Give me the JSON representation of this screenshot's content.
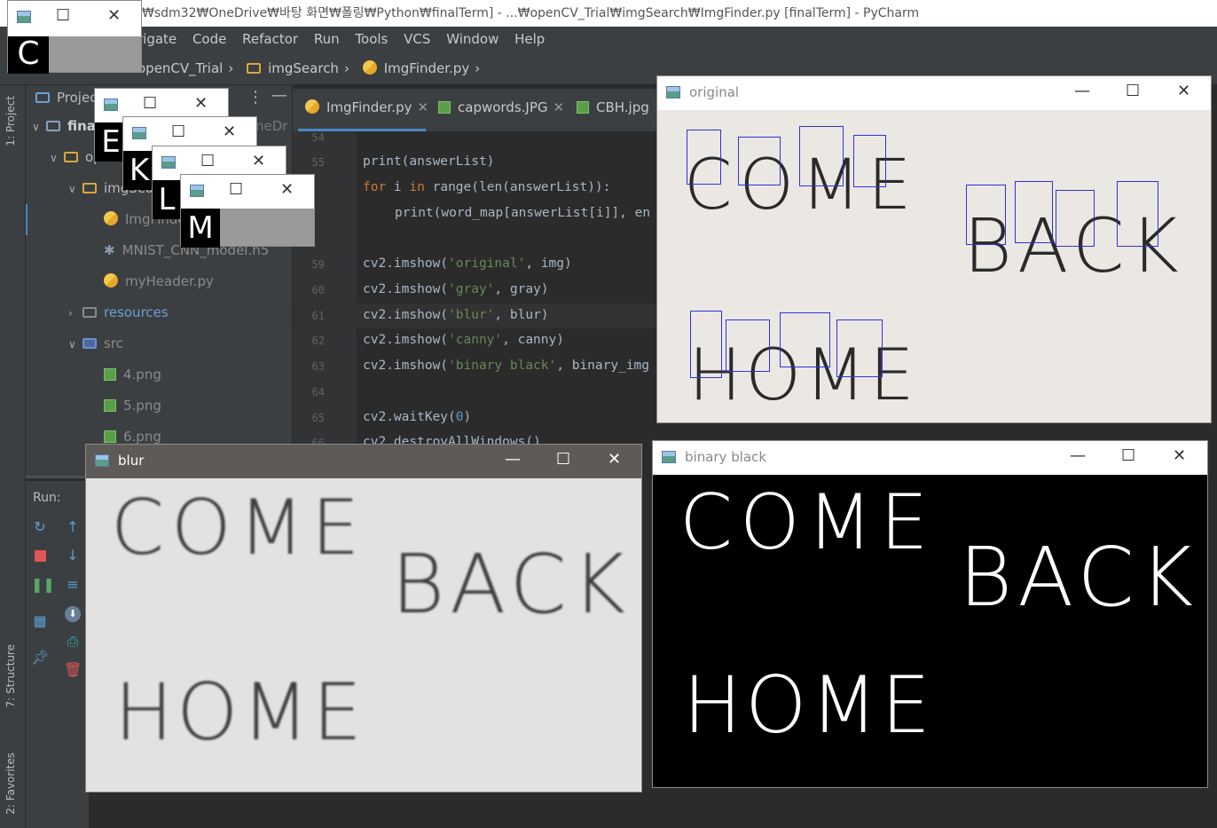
{
  "window_title": "₩sdm32₩OneDrive₩바탕 화면₩폴링₩Python₩finalTerm] - ...₩openCV_Trial₩imgSearch₩ImgFinder.py [finalTerm] - PyCharm",
  "menu": [
    "rigate",
    "Code",
    "Refactor",
    "Run",
    "Tools",
    "VCS",
    "Window",
    "Help"
  ],
  "breadcrumb": [
    "openCV_Trial",
    "imgSearch",
    "ImgFinder.py"
  ],
  "tool_strip": {
    "project": "1: Project",
    "structure": "7: Structure",
    "favorites": "2: Favorites"
  },
  "project": {
    "header": "Projec",
    "rows": [
      {
        "label": "final",
        "icon": "folder"
      },
      {
        "label": "opencv",
        "icon": "folder"
      },
      {
        "label": "imgSear",
        "icon": "folder"
      },
      {
        "label": "ImgFinde",
        "icon": "python"
      },
      {
        "label": "MNIST_CNN_model.h5",
        "icon": "asterisk"
      },
      {
        "label": "myHeader.py",
        "icon": "python"
      },
      {
        "label": "resources",
        "icon": "folder"
      },
      {
        "label": "src",
        "icon": "source-folder"
      },
      {
        "label": "4.png",
        "icon": "image"
      },
      {
        "label": "5.png",
        "icon": "image"
      },
      {
        "label": "6.png",
        "icon": "image"
      }
    ],
    "onedrive_fragment": "neDr"
  },
  "tabs": [
    {
      "label": "ImgFinder.py",
      "active": true
    },
    {
      "label": "capwords.JPG",
      "active": false
    },
    {
      "label": "CBH.jpg",
      "active": false
    }
  ],
  "line_numbers": [
    "54",
    "55",
    "56",
    "57",
    "58",
    "59",
    "60",
    "61",
    "62",
    "63",
    "64",
    "65",
    "66"
  ],
  "code": {
    "l55": "print(answerList)",
    "l56a": "for",
    "l56b": " i ",
    "l56c": "in",
    "l56d": " range(len(answerList)):",
    "l57": "print(word_map[answerList[i]], en",
    "l59a": "cv2.imshow(",
    "l59b": "'original'",
    "l59c": ", img)",
    "l60a": "cv2.imshow(",
    "l60b": "'gray'",
    "l60c": ", gray)",
    "l61a": "cv2.imshow(",
    "l61b": "'blur'",
    "l61c": ", blur)",
    "l62a": "cv2.imshow(",
    "l62b": "'canny'",
    "l62c": ", canny)",
    "l63a": "cv2.imshow(",
    "l63b": "'binary black'",
    "l63c": ", binary_img",
    "l65a": "cv2.waitKey(",
    "l65b": "0",
    "l65c": ")",
    "l66": "cv2.destroyAllWindows()"
  },
  "run_panel": {
    "label": "Run:"
  },
  "windows": {
    "original": {
      "title": "original",
      "row1": "COME",
      "row2": "BACK",
      "row3": "HOME"
    },
    "blur": {
      "title": "blur",
      "row1": "COME",
      "row2": "BACK",
      "row3": "HOME"
    },
    "binary": {
      "title": "binary black",
      "row1": "COME",
      "row2": "BACK",
      "row3": "HOME"
    },
    "small_letters": [
      "C",
      "E",
      "K",
      "L",
      "M"
    ]
  },
  "colors": {
    "bg": "#2b2b2b",
    "panel": "#3c3f41",
    "accent": "#4a88c7",
    "box": "#3030e0"
  }
}
